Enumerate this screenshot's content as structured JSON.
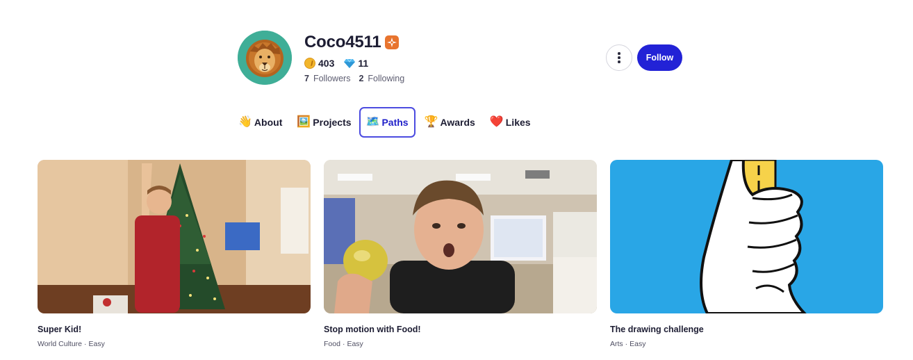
{
  "profile": {
    "username": "Coco4511",
    "coins": "403",
    "gems": "11",
    "followers_count": "7",
    "followers_label": "Followers",
    "following_count": "2",
    "following_label": "Following",
    "avatar_icon": "lion-icon",
    "badge_icon": "sparkle-badge-icon"
  },
  "actions": {
    "follow_label": "Follow",
    "more_icon": "more-vertical-icon"
  },
  "tabs": [
    {
      "emoji": "👋",
      "label": "About"
    },
    {
      "emoji": "🖼️",
      "label": "Projects"
    },
    {
      "emoji": "🗺️",
      "label": "Paths"
    },
    {
      "emoji": "🏆",
      "label": "Awards"
    },
    {
      "emoji": "❤️",
      "label": "Likes"
    }
  ],
  "active_tab": "Paths",
  "cards": [
    {
      "title": "Super Kid!",
      "category": "World Culture",
      "separator": "·",
      "level": "Easy"
    },
    {
      "title": "Stop motion with Food!",
      "category": "Food",
      "separator": "·",
      "level": "Easy"
    },
    {
      "title": "The drawing challenge",
      "category": "Arts",
      "separator": "·",
      "level": "Easy"
    }
  ],
  "colors": {
    "accent": "#2222d6",
    "avatar_bg": "#3fae97",
    "badge": "#e8742e",
    "drawing_bg": "#29a6e6"
  }
}
